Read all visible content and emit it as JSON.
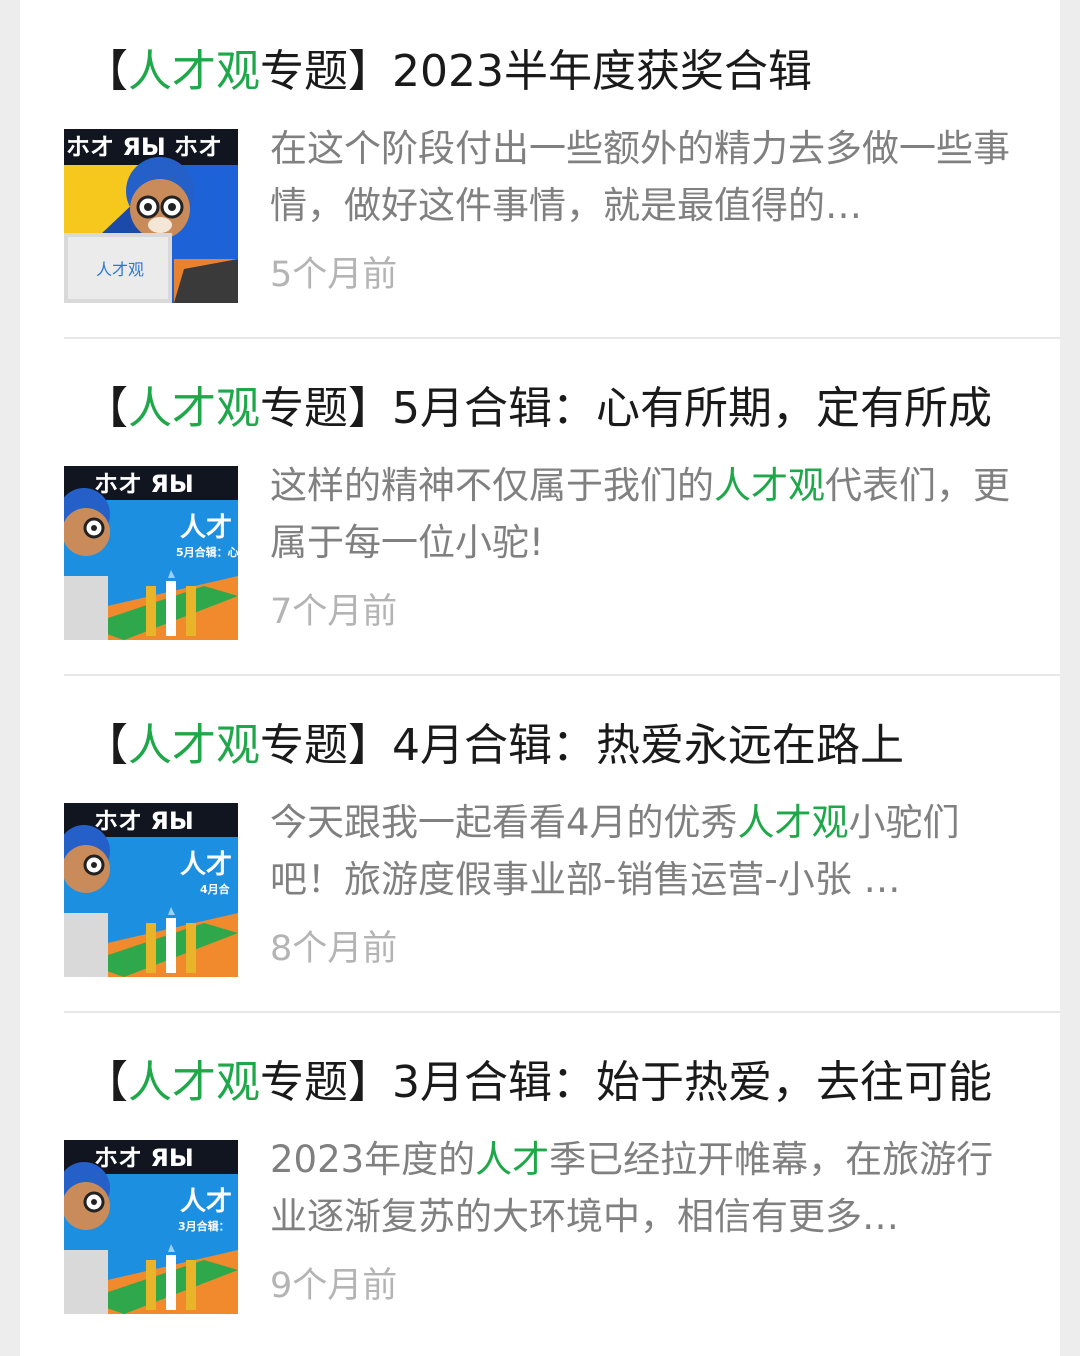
{
  "articles": [
    {
      "title": {
        "bracket_open": "【",
        "highlight": "人才观",
        "label": "专题",
        "bracket_close": "】",
        "rest": "2023半年度获奖合辑"
      },
      "summary": {
        "before": "在这个阶段付出一些额外的精力去多做一些事情，做好这件事情，就是最值得的…",
        "highlight": "",
        "after": ""
      },
      "time": "5个月前",
      "thumbnail": {
        "icon": "mascot-laptop-thumbnail-icon",
        "logo_text": "人才观"
      }
    },
    {
      "title": {
        "bracket_open": "【",
        "highlight": "人才观",
        "label": "专题",
        "bracket_close": "】",
        "rest": "5月合辑：心有所期，定有所成"
      },
      "summary": {
        "before": "这样的精神不仅属于我们的",
        "highlight": "人才观",
        "after": "代表们，更属于每一位小驼!"
      },
      "time": "7个月前",
      "thumbnail": {
        "icon": "mascot-trophy-thumbnail-icon",
        "heading": "人才",
        "subtext": "5月合辑：心"
      }
    },
    {
      "title": {
        "bracket_open": "【",
        "highlight": "人才观",
        "label": "专题",
        "bracket_close": "】",
        "rest": "4月合辑：热爱永远在路上"
      },
      "summary": {
        "before": "今天跟我一起看看4月的优秀",
        "highlight": "人才观",
        "after": "小驼们吧！旅游度假事业部-销售运营-小张 …"
      },
      "time": "8个月前",
      "thumbnail": {
        "icon": "mascot-trophy-thumbnail-icon",
        "heading": "人才",
        "subtext": "4月合"
      }
    },
    {
      "title": {
        "bracket_open": "【",
        "highlight": "人才观",
        "label": "专题",
        "bracket_close": "】",
        "rest": "3月合辑：始于热爱，去往可能"
      },
      "summary": {
        "before": "2023年度的",
        "highlight": "人才",
        "after": "季已经拉开帷幕，在旅游行业逐渐复苏的大环境中，相信有更多…"
      },
      "time": "9个月前",
      "thumbnail": {
        "icon": "mascot-trophy-thumbnail-icon",
        "heading": "人才",
        "subtext": "3月合辑："
      }
    }
  ],
  "colors": {
    "highlight": "#1fa84a",
    "title": "#1a1a1a",
    "summary": "#808080",
    "time": "#b4b4b4"
  }
}
